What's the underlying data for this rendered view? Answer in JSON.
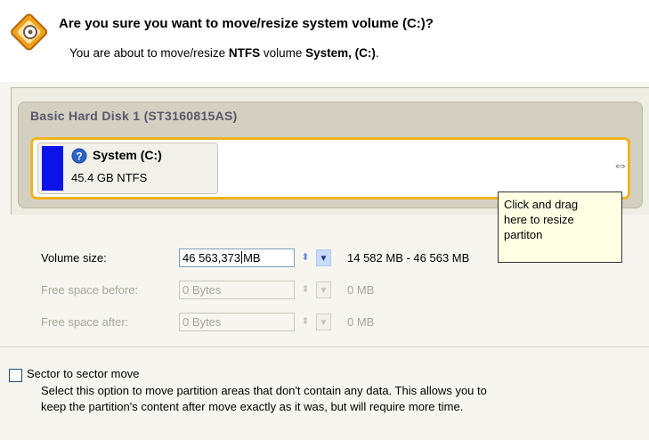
{
  "header": {
    "title": "Are you sure you want to move/resize system volume (C:)?",
    "subtitle_prefix": "You are about to move/resize ",
    "fs_type": "NTFS",
    "subtitle_mid": " volume ",
    "volume_ref": "System, (C:)",
    "subtitle_end": "."
  },
  "disk": {
    "label": "Basic Hard Disk 1 (ST3160815AS)",
    "partition": {
      "name": "System (C:)",
      "info": "45.4 GB NTFS",
      "color": "#0a14e6",
      "icon": "help-icon"
    }
  },
  "tooltip": {
    "lines": [
      "Click and drag",
      "here to resize",
      "partiton"
    ]
  },
  "fields": {
    "volume_size": {
      "label": "Volume size:",
      "value_before_caret": "46 563,373",
      "value_after_caret": "MB",
      "range": "14 582 MB - 46 563 MB"
    },
    "free_before": {
      "label": "Free space before:",
      "value": "0 Bytes",
      "range": "0 MB"
    },
    "free_after": {
      "label": "Free space after:",
      "value": "0 Bytes",
      "range": "0 MB"
    }
  },
  "sector_move": {
    "label": "Sector to sector move",
    "checked": false,
    "description_line1": "Select this option to move partition areas that don't contain any data. This allows you to",
    "description_line2": "keep the partition's content after move exactly as it was, but will require more time."
  },
  "colors": {
    "accent": "#f3b21f",
    "partition_bar": "#0a14e6",
    "tooltip_bg": "#ffffe4"
  }
}
